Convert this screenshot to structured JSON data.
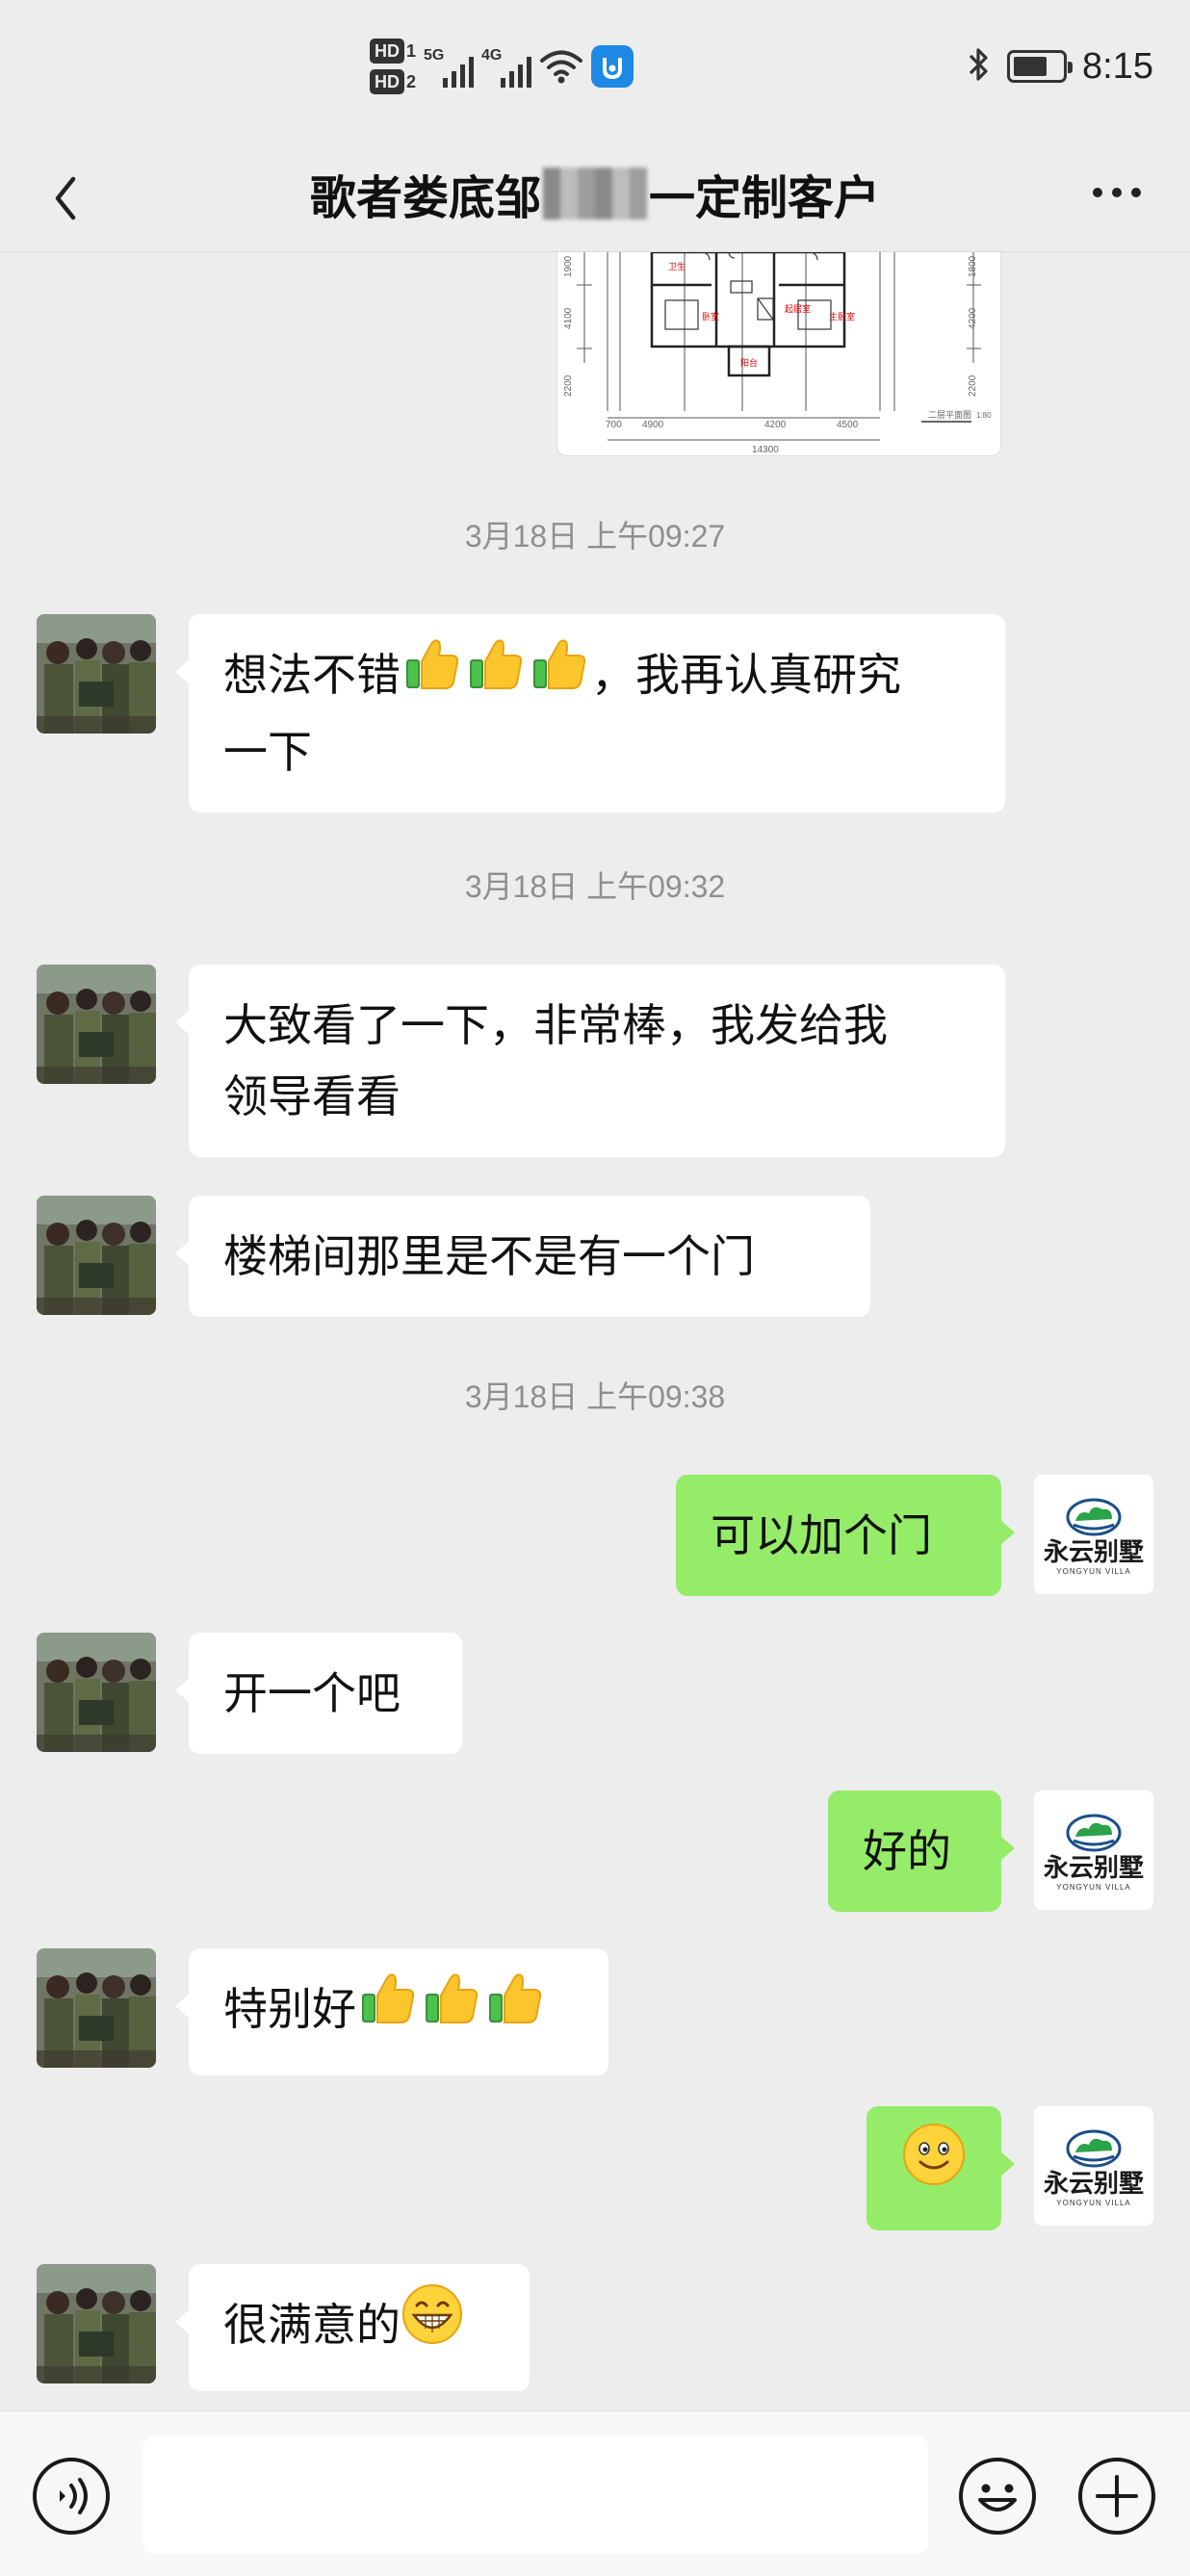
{
  "status_bar": {
    "hd1": "HD",
    "hd1_sub": "1",
    "hd2": "HD",
    "hd2_sub": "2",
    "network1": "5G",
    "network2": "4G",
    "time": "8:15",
    "battery_level": 0.7,
    "icons": [
      "hd-icon",
      "signal-icon",
      "wifi-icon",
      "app-notification-icon",
      "bluetooth-icon",
      "battery-icon"
    ]
  },
  "header": {
    "title_before": "歌者娄底邹",
    "title_after": "一定制客户"
  },
  "floor_plan": {
    "dims_left": [
      "1900",
      "4100",
      "2200"
    ],
    "dims_right": [
      "1800",
      "4200",
      "2200"
    ],
    "dims_bottom": [
      "700",
      "4900",
      "4200",
      "4500"
    ],
    "total_width": "14300",
    "rooms": [
      "卫生",
      "起居室",
      "卧室",
      "主卧室",
      "阳台"
    ],
    "caption": "二层平面图",
    "scale": "1:80"
  },
  "messages": [
    {
      "type": "time",
      "text": "3月18日 上午09:27"
    },
    {
      "type": "received",
      "line1": "想法不错",
      "suffix1": "，我再认真研究",
      "line2": "一下",
      "emoji": [
        "thumbs-up",
        "thumbs-up",
        "thumbs-up"
      ]
    },
    {
      "type": "time",
      "text": "3月18日 上午09:32"
    },
    {
      "type": "received",
      "line1": "大致看了一下，非常棒，我发给我",
      "line2": "领导看看"
    },
    {
      "type": "received",
      "text": "楼梯间那里是不是有一个门"
    },
    {
      "type": "time",
      "text": "3月18日 上午09:38"
    },
    {
      "type": "sent",
      "text": "可以加个门"
    },
    {
      "type": "received",
      "text": "开一个吧"
    },
    {
      "type": "sent",
      "text": "好的"
    },
    {
      "type": "received",
      "text": "特别好",
      "emoji": [
        "thumbs-up",
        "thumbs-up",
        "thumbs-up"
      ]
    },
    {
      "type": "sent",
      "emoji": [
        "smiley"
      ]
    },
    {
      "type": "received",
      "text": "很满意的",
      "emoji": [
        "grinning"
      ]
    }
  ],
  "brand": {
    "name": "永云别墅",
    "subtitle": "YONGYUN VILLA"
  },
  "input_bar": {
    "value": "",
    "icons": [
      "voice-icon",
      "emoji-icon",
      "plus-icon"
    ]
  },
  "colors": {
    "background": "#ededed",
    "sent_bubble": "#95ec69",
    "received_bubble": "#ffffff",
    "timestamp": "#8f8f8f"
  }
}
